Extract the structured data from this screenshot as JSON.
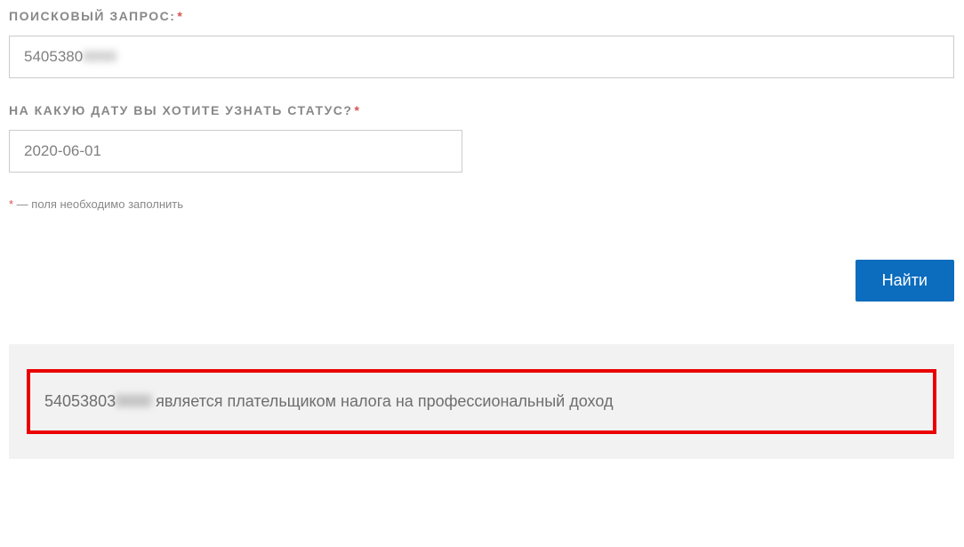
{
  "form": {
    "search": {
      "label": "ПОИСКОВЫЙ ЗАПРОС:",
      "required_mark": "*",
      "value_prefix": "5405380",
      "value_hidden": "0000"
    },
    "date": {
      "label": "НА КАКУЮ ДАТУ ВЫ ХОТИТЕ УЗНАТЬ СТАТУС?",
      "required_mark": "*",
      "value": "2020-06-01"
    },
    "hint": {
      "star": "*",
      "text": " — поля необходимо заполнить"
    },
    "submit_label": "Найти"
  },
  "result": {
    "id_prefix": "54053803",
    "id_hidden": "0000",
    "message": " является плательщиком налога на профессиональный доход"
  }
}
